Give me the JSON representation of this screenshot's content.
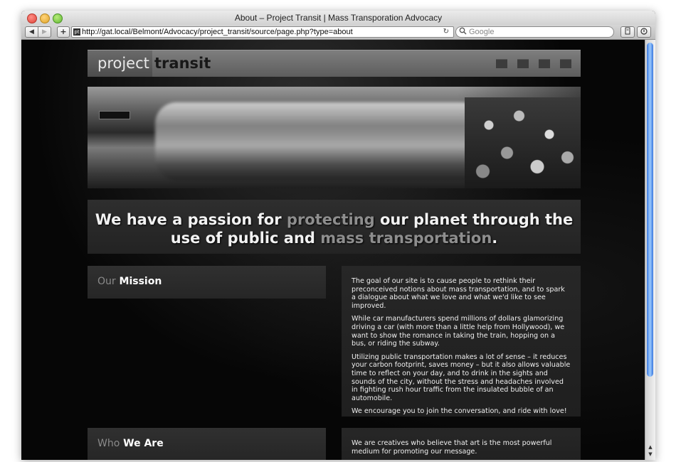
{
  "browser": {
    "window_title": "About – Project Transit | Mass Transporation Advocacy",
    "url": "http://gat.local/Belmont/Advocacy/project_transit/source/page.php?type=about",
    "search_placeholder": "Google",
    "back_glyph": "◀",
    "forward_glyph": "▶",
    "add_glyph": "+",
    "reload_glyph": "↻",
    "search_glyph": "🔍",
    "favicon_text": "pt"
  },
  "site": {
    "logo_part1": "project",
    "logo_part2": "transit",
    "nav_items": [
      "nav-1",
      "nav-2",
      "nav-3",
      "nav-4"
    ],
    "tagline": {
      "part1": "We have a passion for ",
      "highlight1": "protecting",
      "part2": " our planet through the use of public and ",
      "highlight2": "mass transportation",
      "part3": "."
    },
    "sections": [
      {
        "heading_dim": "Our",
        "heading_bright": "Mission",
        "paragraphs": [
          "The goal of our site is to cause people to rethink their preconceived notions about mass transportation, and to spark a dialogue about what we love and what we'd like to see improved.",
          "While car manufacturers spend millions of dollars glamorizing driving a car (with more than a little help from Hollywood), we want to show the romance in taking the train, hopping on a bus, or riding the subway.",
          "Utilizing public transportation makes a lot of sense – it reduces your carbon footprint, saves money – but it also allows valuable time to reflect on your day, and to drink in the sights and sounds of the city, without the stress and headaches involved in fighting rush hour traffic from the insulated bubble of an automobile.",
          "We encourage you to join the conversation, and ride with love!"
        ]
      },
      {
        "heading_dim": "Who",
        "heading_bright": "We Are",
        "paragraphs": [
          "We are creatives who believe that art is the most powerful medium for promoting our message."
        ]
      }
    ]
  },
  "colors": {
    "page_bg": "#060606",
    "panel_bg": "#262626",
    "dim_text": "#8e8e8e",
    "scroll_thumb": "#3b7ae0"
  }
}
